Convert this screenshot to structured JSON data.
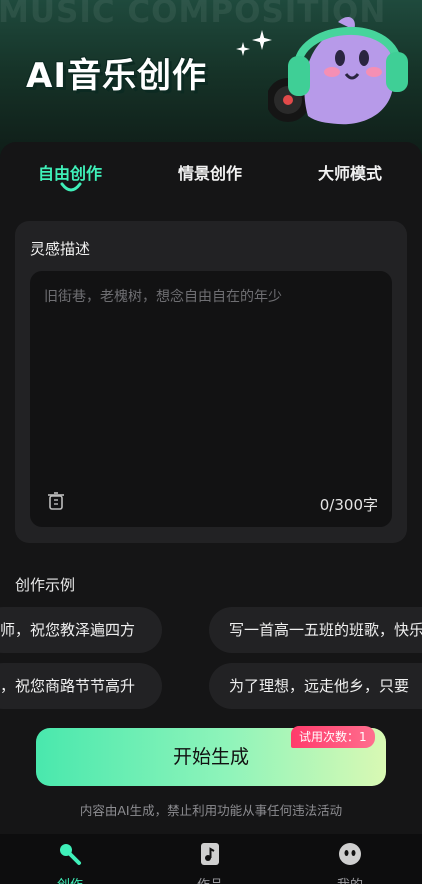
{
  "hero": {
    "watermark": "MUSIC COMPOSITION",
    "title": "AI音乐创作"
  },
  "tabs": [
    {
      "label": "自由创作",
      "active": true
    },
    {
      "label": "情景创作",
      "active": false
    },
    {
      "label": "大师模式",
      "active": false
    }
  ],
  "inspiration": {
    "label": "灵感描述",
    "placeholder": "旧街巷，老槐树，想念自由自在的年少",
    "counter": "0/300字"
  },
  "examples": {
    "title": "创作示例",
    "chips": [
      "师，祝您教泽遍四方",
      "写一首高一五班的班歌，快乐的",
      "，祝您商路节节高升",
      "为了理想，远走他乡，只要"
    ]
  },
  "generate": {
    "label": "开始生成",
    "badge": "试用次数：1"
  },
  "disclaimer": "内容由AI生成，禁止利用功能从事任何违法活动",
  "bottom_nav": [
    {
      "label": "创作",
      "icon": "microphone-icon",
      "active": true
    },
    {
      "label": "作品",
      "icon": "music-file-icon",
      "active": false
    },
    {
      "label": "我的",
      "icon": "profile-face-icon",
      "active": false
    }
  ],
  "colors": {
    "accent": "#3ff0b9",
    "background": "#0b0b0c",
    "card": "#222224",
    "badge": "#ff3b6b"
  }
}
